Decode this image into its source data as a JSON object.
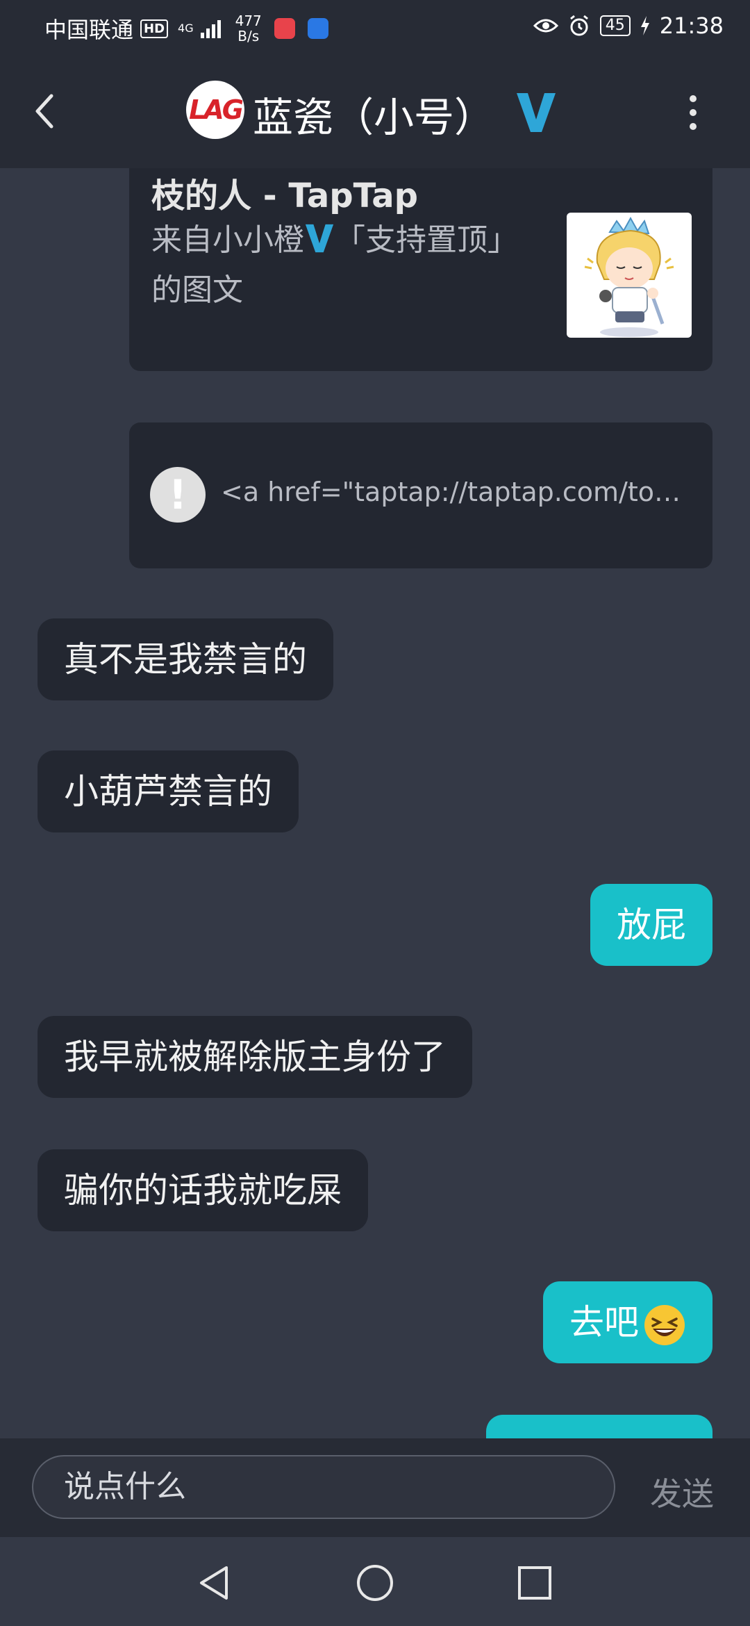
{
  "status_bar": {
    "carrier": "中国联通",
    "hd": "HD",
    "network": "4G",
    "speed_value": "477",
    "speed_unit": "B/s",
    "battery": "45",
    "time": "21:38"
  },
  "header": {
    "avatar_text": "LAG",
    "title": "蓝瓷（小号）"
  },
  "share_card": {
    "title": "枝的人 - TapTap",
    "desc_prefix": "来自小小橙",
    "desc_suffix": "「支持置顶」的图文"
  },
  "link_card": {
    "text": "<a href=\"taptap://taptap.com/topic?..."
  },
  "messages": [
    {
      "side": "in",
      "text": "真不是我禁言的"
    },
    {
      "side": "in",
      "text": "小葫芦禁言的"
    },
    {
      "side": "out",
      "text": "放屁"
    },
    {
      "side": "in",
      "text": "我早就被解除版主身份了"
    },
    {
      "side": "in",
      "text": "骗你的话我就吃屎"
    },
    {
      "side": "out",
      "text": "去吧"
    }
  ],
  "input": {
    "placeholder": "说点什么",
    "send_label": "发送"
  },
  "colors": {
    "background": "#343946",
    "bar": "#272b35",
    "incoming_bubble": "#232731",
    "outgoing_bubble": "#19c0c9",
    "verified_badge": "#2ea6d8"
  }
}
